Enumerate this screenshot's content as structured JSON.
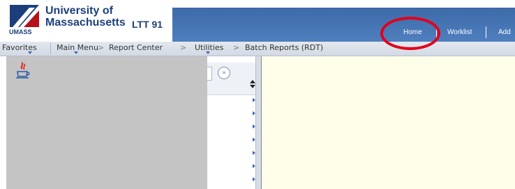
{
  "logo": {
    "line1": "University of",
    "line2": "Massachusetts",
    "ltt": "LTT 91",
    "umass": "UMASS"
  },
  "header": {
    "links": [
      "Home",
      "Worklist",
      "Add"
    ]
  },
  "nav": {
    "favorites": "Favorites",
    "main_menu": "Main Menu",
    "crumbs": [
      "Report Center",
      "Utilities",
      "Batch Reports (RDT)"
    ],
    "separator": ">"
  },
  "sidebar": {
    "collapse_glyph": "»",
    "item_count": 7
  },
  "colors": {
    "brand": "#1c3f7c",
    "banner": "#4575b4",
    "highlight_circle": "#e2001a",
    "content_bg": "#ffffe9",
    "gray_panel": "#c4c4c4"
  },
  "icons": [
    "java-coffee-icon",
    "collapse-menu-icon",
    "sort-icon",
    "chevron-right-icon"
  ]
}
